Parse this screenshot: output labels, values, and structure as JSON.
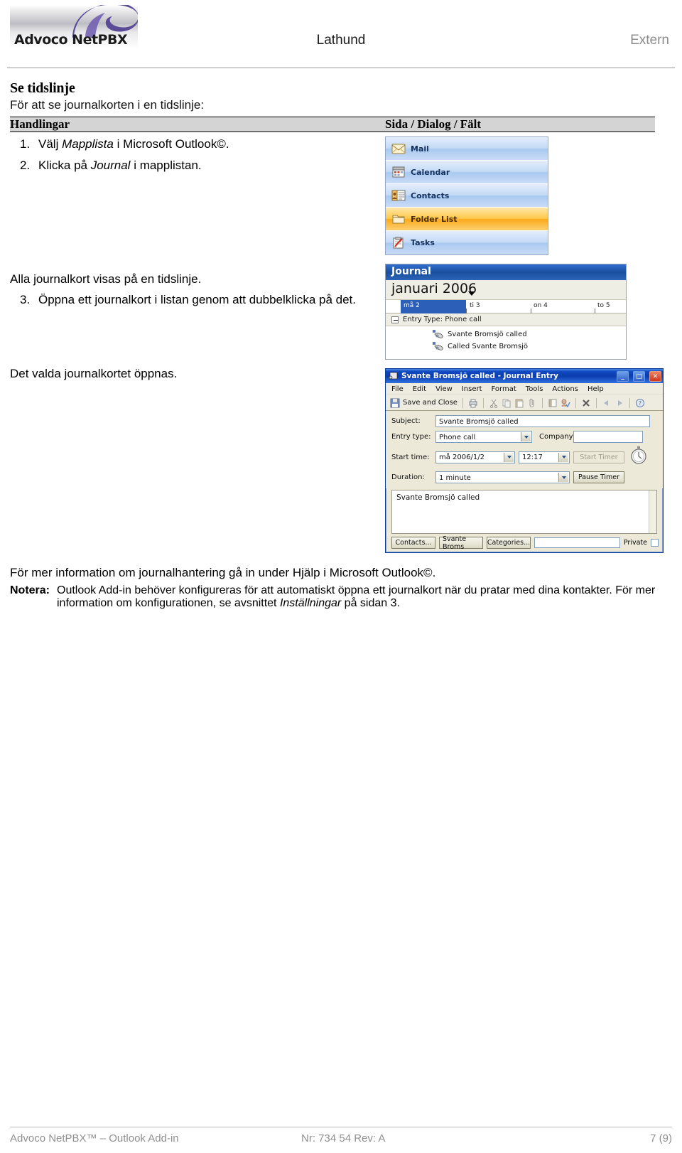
{
  "header": {
    "logo_text": "Advoco NetPBX",
    "title": "Lathund",
    "right_label": "Extern"
  },
  "section": {
    "heading": "Se tidslinje",
    "lead": "För att se journalkorten i en tidslinje:"
  },
  "table": {
    "col_actions_header": "Handlingar",
    "col_screen_header": "Sida / Dialog / Fält",
    "steps": [
      {
        "num": "1.",
        "pre": "Välj ",
        "em": "Mapplista",
        "post": " i Microsoft Outlook©."
      },
      {
        "num": "2.",
        "pre": "Klicka på ",
        "em": "Journal",
        "post": " i mapplistan."
      }
    ],
    "para_all_cards": "Alla journalkort visas på en tidslinje.",
    "step3": {
      "num": "3.",
      "text": "Öppna ett journalkort i listan genom att dubbelklicka på det."
    },
    "para_opened": "Det valda journalkortet öppnas."
  },
  "outlook_nav": {
    "items": [
      {
        "label": "Mail",
        "icon": "mail-icon",
        "selected": false
      },
      {
        "label": "Calendar",
        "icon": "calendar-icon",
        "selected": false
      },
      {
        "label": "Contacts",
        "icon": "contacts-icon",
        "selected": false
      },
      {
        "label": "Folder List",
        "icon": "folder-icon",
        "selected": true
      },
      {
        "label": "Tasks",
        "icon": "tasks-icon",
        "selected": false
      }
    ]
  },
  "journal_view": {
    "title": "Journal",
    "month": "januari 2006",
    "days": [
      "må 2",
      "ti 3",
      "on 4",
      "to 5"
    ],
    "group_label": "Entry Type: Phone call",
    "entries": [
      "Svante Bromsjö called",
      "Called Svante Bromsjö"
    ]
  },
  "journal_dialog": {
    "title": "Svante Bromsjö called  -  Journal Entry",
    "window_buttons": [
      "minimize",
      "maximize",
      "close"
    ],
    "menu": [
      "File",
      "Edit",
      "View",
      "Insert",
      "Format",
      "Tools",
      "Actions",
      "Help"
    ],
    "toolbar_save_label": "Save and Close",
    "fields": {
      "subject_label": "Subject:",
      "subject_value": "Svante Bromsjö called",
      "entry_type_label": "Entry type:",
      "entry_type_value": "Phone call",
      "company_label": "Company:",
      "company_value": "",
      "start_time_label": "Start time:",
      "start_date_value": "må 2006/1/2",
      "start_clock_value": "12:17",
      "start_timer_button": "Start Timer",
      "duration_label": "Duration:",
      "duration_value": "1 minute",
      "pause_timer_button": "Pause Timer"
    },
    "note_body": "Svante Bromsjö called",
    "footer_buttons": [
      "Contacts...",
      "Svante Broms",
      "Categories..."
    ],
    "private_label": "Private"
  },
  "closing": {
    "p1": "För mer information om journalhantering gå in under Hjälp i Microsoft Outlook©.",
    "note_label": "Notera:",
    "note_pre": "Outlook Add-in behöver konfigureras för att automatiskt öppna ett journalkort när du pratar med dina kontakter. För mer information om konfigurationen, se avsnittet ",
    "note_em": "Inställningar",
    "note_post": " på sidan 3."
  },
  "footer": {
    "left": "Advoco NetPBX™ – Outlook Add-in",
    "center": "Nr: 734 54 Rev: A",
    "right": "7 (9)"
  },
  "colors": {
    "accent_blue": "#1b4f9e",
    "selected_orange": "#fbaa1d",
    "header_gray": "#d4d4d4",
    "footer_gray": "#8f8f8f"
  }
}
